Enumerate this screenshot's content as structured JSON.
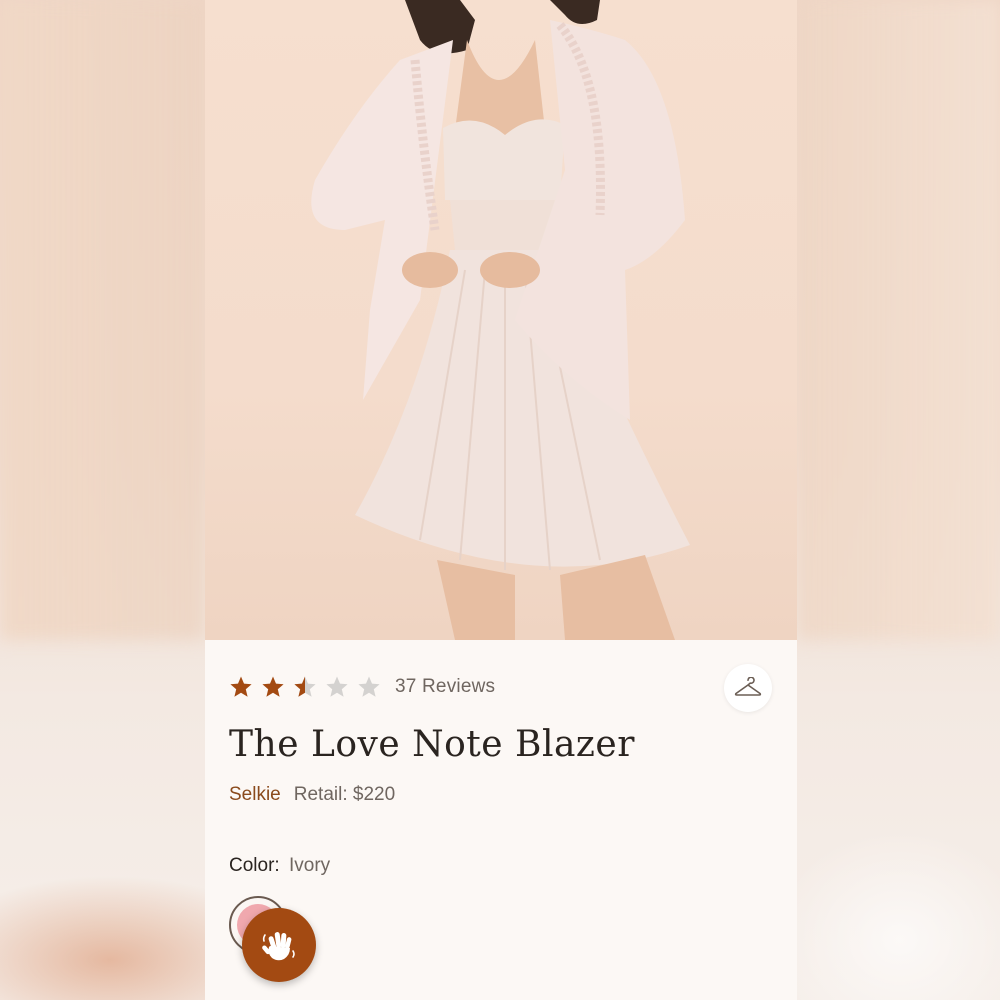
{
  "product": {
    "rating": 2.5,
    "rating_max": 5,
    "reviews_label": "37 Reviews",
    "title": "The Love Note Blazer",
    "brand": "Selkie",
    "retail_label": "Retail: $220",
    "color_label": "Color:",
    "color_value": "Ivory",
    "swatch_color": "#f0a8ae"
  },
  "colors": {
    "accent": "#a34a12",
    "star_filled": "#a34a12",
    "star_empty": "#d4d2d0",
    "brand_text": "#8a4a1c"
  },
  "icons": {
    "save": "hanger-icon",
    "chat": "waving-hand-icon",
    "rating": "star-icon"
  }
}
